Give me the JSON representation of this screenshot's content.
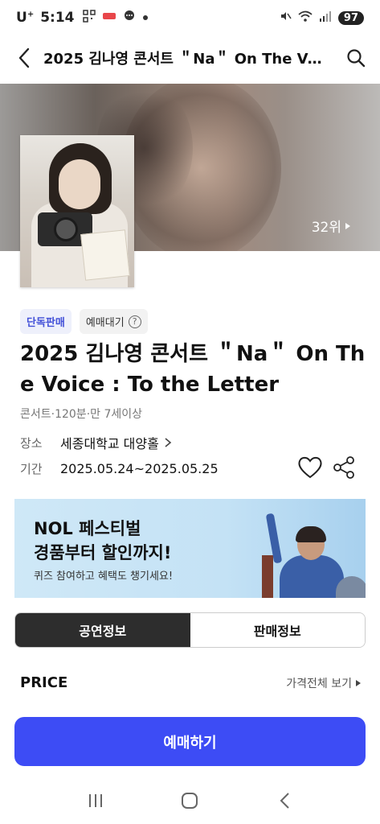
{
  "status_bar": {
    "carrier": "U",
    "carrier_sup": "+",
    "time": "5:14",
    "notif_icons": [
      "qr-icon",
      "shopping-icon",
      "chat-icon",
      "dot-icon"
    ],
    "battery": "97"
  },
  "header": {
    "title": "2025 김나영 콘서트 ＂Na＂ On The Voice : To the Letter"
  },
  "hero": {
    "rank": "32위"
  },
  "badges": {
    "exclusive": "단독판매",
    "waitlist": "예매대기"
  },
  "event": {
    "title": "2025 김나영 콘서트 ＂Na＂ On The Voice : To the Letter",
    "meta": "콘서트·120분·만 7세이상",
    "venue_label": "장소",
    "venue": "세종대학교 대양홀",
    "period_label": "기간",
    "period": "2025.05.24~2025.05.25"
  },
  "banner": {
    "line1": "NOL 페스티벌",
    "line2": "경품부터 할인까지!",
    "sub": "퀴즈 참여하고 혜택도 챙기세요!"
  },
  "tabs": [
    {
      "label": "공연정보",
      "active": true
    },
    {
      "label": "판매정보",
      "active": false
    }
  ],
  "price": {
    "label": "PRICE",
    "view_all": "가격전체 보기"
  },
  "cta": {
    "label": "예매하기"
  },
  "colors": {
    "accent": "#3d4cf5",
    "badge_text": "#4250d8",
    "tab_active": "#2d2d2d"
  }
}
